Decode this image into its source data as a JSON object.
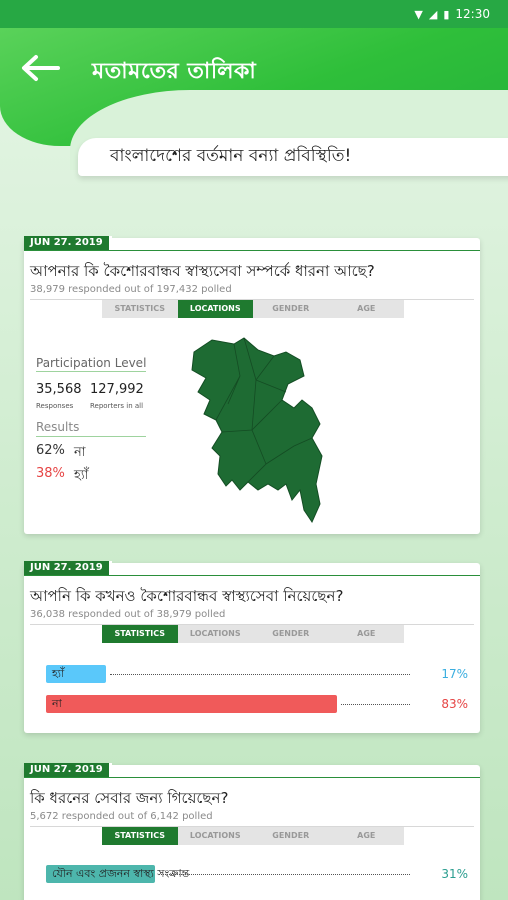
{
  "status_bar": {
    "time": "12:30"
  },
  "header": {
    "title": "মতামতের তালিকা",
    "subtitle": "বাংলাদেশের বর্তমান বন্যা প্রবিস্থিতি!"
  },
  "colors": {
    "primary": "#27a844",
    "dark_green": "#1f7a2f",
    "blue_bar": "#5ac8fa",
    "red_bar": "#f05a5a",
    "teal_bar": "#4db6ac"
  },
  "polls": [
    {
      "date": "JUN 27. 2019",
      "question": "আপনার কি কৈশোরবান্ধব স্বাস্থ্যসেবা সম্পর্কে ধারনা আছে?",
      "responded": "38,979 responded out of 197,432 polled",
      "tabs": [
        "STATISTICS",
        "LOCATIONS",
        "GENDER",
        "AGE"
      ],
      "active_tab": "LOCATIONS",
      "participation_label": "Participation Level",
      "responses": "35,568",
      "responses_label": "Responses",
      "reporters": "127,992",
      "reporters_label": "Reporters in all",
      "results_label": "Results",
      "results": [
        {
          "percent": "62%",
          "label": "না"
        },
        {
          "percent": "38%",
          "label": "হ্যাঁ"
        }
      ]
    },
    {
      "date": "JUN 27. 2019",
      "question": "আপনি কি কখনও কৈশোরবান্ধব স্বাস্থ্যসেবা নিয়েছেন?",
      "responded": "36,038 responded out of 38,979 polled",
      "tabs": [
        "STATISTICS",
        "LOCATIONS",
        "GENDER",
        "AGE"
      ],
      "active_tab": "STATISTICS",
      "bars": [
        {
          "label": "হ্যাঁ",
          "percent": "17%",
          "value": 17
        },
        {
          "label": "না",
          "percent": "83%",
          "value": 83
        }
      ]
    },
    {
      "date": "JUN 27. 2019",
      "question": "কি ধরনের সেবার জন্য গিয়েছেন?",
      "responded": "5,672 responded out of 6,142 polled",
      "tabs": [
        "STATISTICS",
        "LOCATIONS",
        "GENDER",
        "AGE"
      ],
      "active_tab": "STATISTICS",
      "bars": [
        {
          "label": "যৌন এবং প্রজনন স্বাস্থ্য সংক্রান্ত",
          "percent": "31%",
          "value": 31
        }
      ]
    }
  ]
}
